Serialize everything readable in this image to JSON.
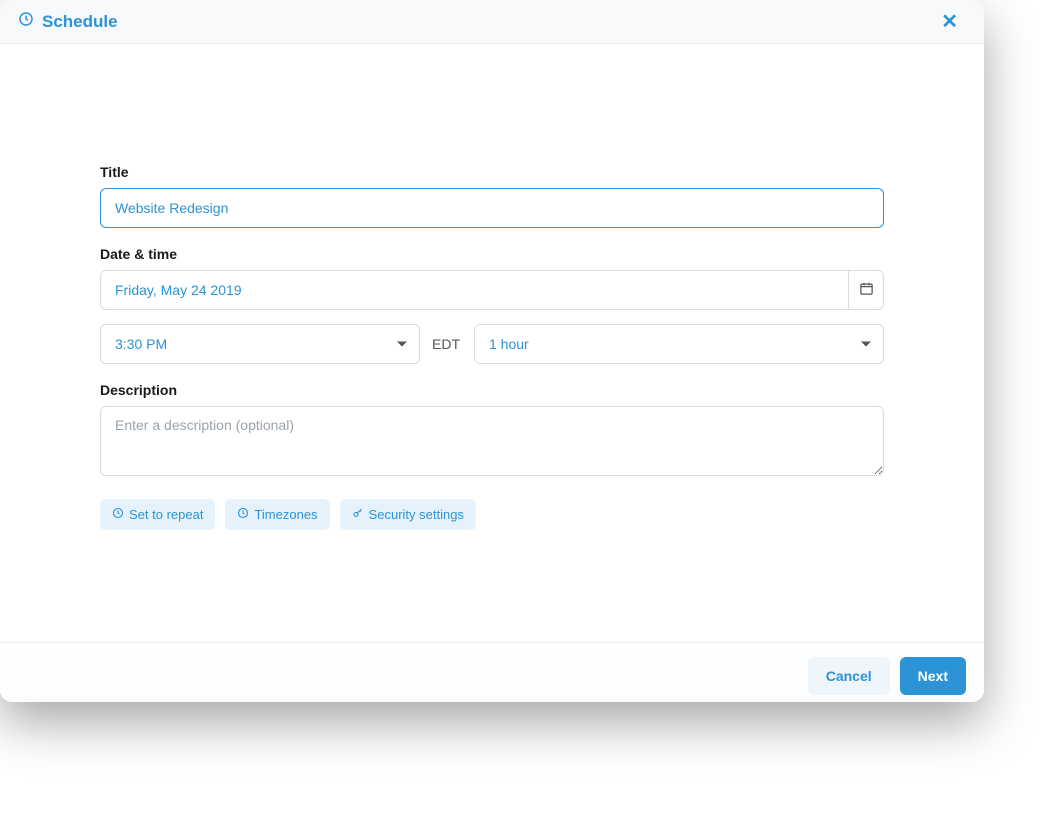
{
  "header": {
    "title": "Schedule"
  },
  "form": {
    "title_label": "Title",
    "title_value": "Website Redesign",
    "datetime_label": "Date & time",
    "date_value": "Friday, May 24 2019",
    "time_value": "3:30 PM",
    "timezone": "EDT",
    "duration_value": "1 hour",
    "description_label": "Description",
    "description_placeholder": "Enter a description (optional)",
    "description_value": ""
  },
  "chips": {
    "repeat": "Set to repeat",
    "timezones": "Timezones",
    "security": "Security settings"
  },
  "footer": {
    "cancel": "Cancel",
    "next": "Next"
  }
}
